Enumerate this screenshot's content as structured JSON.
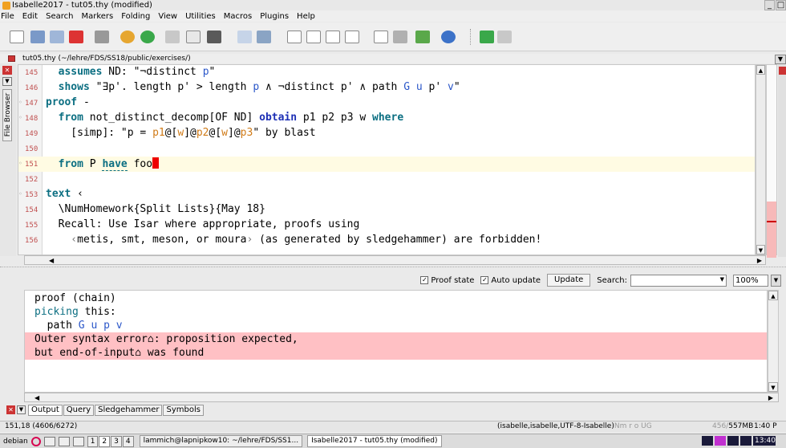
{
  "window": {
    "title": "Isabelle2017 - tut05.thy (modified)",
    "controls": [
      "_",
      "□"
    ]
  },
  "menu": [
    "File",
    "Edit",
    "Search",
    "Markers",
    "Folding",
    "View",
    "Utilities",
    "Macros",
    "Plugins",
    "Help"
  ],
  "toolbar_icons": [
    "new-file-icon",
    "open-folder-icon",
    "reload-icon",
    "close-file-icon",
    "print-icon",
    "undo-icon",
    "redo-icon",
    "cut-icon",
    "copy-icon",
    "paste-icon",
    "find-icon",
    "find-replace-icon",
    "new-window-icon",
    "split-horizontal-icon",
    "split-vertical-icon",
    "unsplit-icon",
    "fullscreen-icon",
    "tools-icon",
    "plugin-icon",
    "help-icon",
    "back-icon",
    "forward-icon"
  ],
  "file_tab": {
    "label": "tut05.thy (~/lehre/FDS/SS18/public/exercises/)"
  },
  "left_dock": {
    "label": "File Browser"
  },
  "editor": {
    "lines": [
      {
        "num": "145",
        "marker": false,
        "highlight": false
      },
      {
        "num": "146",
        "marker": false,
        "highlight": false
      },
      {
        "num": "147",
        "marker": true,
        "highlight": false
      },
      {
        "num": "148",
        "marker": true,
        "highlight": false
      },
      {
        "num": "149",
        "marker": false,
        "highlight": false
      },
      {
        "num": "150",
        "marker": false,
        "highlight": false
      },
      {
        "num": "151",
        "marker": true,
        "highlight": true
      },
      {
        "num": "152",
        "marker": false,
        "highlight": false
      },
      {
        "num": "153",
        "marker": true,
        "highlight": false
      },
      {
        "num": "154",
        "marker": false,
        "highlight": false
      },
      {
        "num": "155",
        "marker": false,
        "highlight": false
      },
      {
        "num": "156",
        "marker": false,
        "highlight": false
      }
    ],
    "code": {
      "l145_kw": "assumes",
      "l145_rest": " ND: \"¬distinct ",
      "l145_p": "p",
      "l145_end": "\"",
      "l146_kw": "shows",
      "l146_a": " \"∃",
      "l146_p1": "p'",
      "l146_b": ". length ",
      "l146_p2": "p'",
      "l146_c": " > length ",
      "l146_p3": "p",
      "l146_d": " ∧ ¬distinct ",
      "l146_p4": "p'",
      "l146_e": " ∧ path ",
      "l146_g": "G",
      "l146_sp1": " ",
      "l146_u": "u",
      "l146_sp2": " ",
      "l146_p5": "p'",
      "l146_sp3": " ",
      "l146_v": "v",
      "l146_end": "\"",
      "l147_kw": "proof",
      "l147_rest": " -",
      "l148_kw": "from",
      "l148_a": " not_distinct_decomp[OF ND] ",
      "l148_obtain": "obtain",
      "l148_vars": " p1 p2 p3 w ",
      "l148_where": "where",
      "l149_a": "  [simp]: \"p = ",
      "l149_p1": "p1",
      "l149_at1": "@[",
      "l149_w1": "w",
      "l149_at2": "]@",
      "l149_p2": "p2",
      "l149_at3": "@[",
      "l149_w2": "w",
      "l149_at4": "]@",
      "l149_p3": "p3",
      "l149_b": "\" by blast",
      "l151_kw": "from",
      "l151_a": " P ",
      "l151_have": "have",
      "l151_b": " foo",
      "l153_kw": "text",
      "l153_rest": " ‹",
      "l154_text": "  \\NumHomework{Split Lists}{May 18}",
      "l155_text": "  Recall: Use Isar where appropriate, proofs using",
      "l156_open": "    ‹",
      "l156_text": "metis, smt, meson, or moura",
      "l156_close": "›",
      "l156_rest": " (as generated by sledgehammer) are forbidden!"
    }
  },
  "output_toolbar": {
    "proof_state": "Proof state",
    "auto_update": "Auto update",
    "update_button": "Update",
    "search_label": "Search:",
    "search_value": "",
    "zoom": "100%"
  },
  "output": {
    "l1": "proof (chain)",
    "l2_kw": "picking",
    "l2_rest": " this:",
    "l3_a": "  path ",
    "l3_g": "G",
    "l3_s1": " ",
    "l3_u": "u",
    "l3_s2": " ",
    "l3_p": "p",
    "l3_s3": " ",
    "l3_v": "v",
    "l4": "Outer syntax error⌂: proposition expected,",
    "l5": "but end-of-input⌂ was found"
  },
  "dock_tabs": [
    "Output",
    "Query",
    "Sledgehammer",
    "Symbols"
  ],
  "status": {
    "position": "151,18 (4606/6272)",
    "mode": "(isabelle,isabelle,UTF-8-Isabelle)",
    "flags": "Nm r o UG",
    "mem_a": "456/",
    "mem_b": "557MB",
    "time": "1:40 P"
  },
  "taskbar": {
    "debian": "debian",
    "workspaces": [
      "1",
      "2",
      "3",
      "4"
    ],
    "tasks": [
      "lammich@lapnipkow10: ~/lehre/FDS/SS1...",
      "Isabelle2017 - tut05.thy (modified)"
    ],
    "clock": "13:40"
  },
  "colors": {
    "keyword": "#0c6f82",
    "free_var": "#2b57c9",
    "error_bg": "#ffc0c4",
    "highlight_line": "#fffbe3",
    "cursor": "#e00000"
  }
}
